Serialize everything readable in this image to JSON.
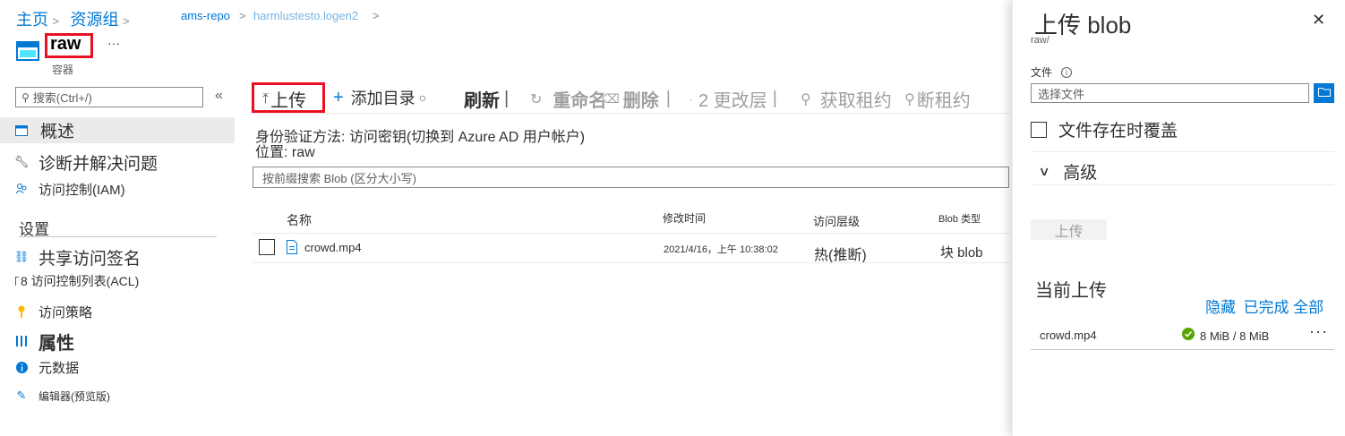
{
  "breadcrumb": {
    "home": "主页",
    "resource_group": "资源组",
    "repo": "ams-repo",
    "account": "harmlustesto.logen2",
    "sep": ">"
  },
  "container": {
    "name": "raw",
    "subtitle": "容器",
    "more": "···"
  },
  "sidebar": {
    "search_placeholder": "搜索(Ctrl+/)",
    "collapse": "«",
    "items": [
      {
        "label": "概述",
        "icon": "container-icon"
      },
      {
        "label": "诊断并解决问题",
        "icon": "wrench-icon"
      },
      {
        "label": "访问控制(IAM)",
        "icon": "people-icon"
      }
    ],
    "settings_header": "设置",
    "settings_items": [
      {
        "label": "共享访问签名",
        "icon": "link-icon"
      },
      {
        "label": "8 访问控制列表(ACL)",
        "icon": "acl-icon"
      },
      {
        "label": "访问策略",
        "icon": "key-icon"
      },
      {
        "label": "属性",
        "icon": "properties-icon"
      },
      {
        "label": "元数据",
        "icon": "info-icon"
      },
      {
        "label": "编辑器(预览版)",
        "icon": "pencil-icon"
      }
    ]
  },
  "toolbar": {
    "upload": "上传",
    "add_directory": "添加目录",
    "refresh": "刷新",
    "rename": "重命名",
    "delete": "删除",
    "change_tier": "2 更改层",
    "acquire_lease": "获取租约",
    "break_lease": "断租约"
  },
  "main": {
    "auth_method": "身份验证方法: 访问密钥(切换到 Azure AD 用户帐户)",
    "location": "位置: raw",
    "search_placeholder": "按前缀搜索 Blob (区分大小写)",
    "columns": [
      "名称",
      "修改时间",
      "访问层级",
      "Blob 类型"
    ],
    "rows": [
      {
        "name": "crowd.mp4",
        "modified": "2021/4/16，上午 10:38:02",
        "tier": "热(推断)",
        "blob_type": "块 blob"
      }
    ]
  },
  "panel": {
    "title": "上传 blob",
    "subtitle": "raw/",
    "close": "✕",
    "file_label": "文件",
    "file_placeholder": "选择文件",
    "overwrite_label": "文件存在时覆盖",
    "advanced_label": "高级",
    "upload_button": "上传",
    "current_uploads": "当前上传",
    "hide": "隐藏",
    "completed_all": "已完成 全部",
    "upload_item": {
      "name": "crowd.mp4",
      "progress_text": "8 MiB / 8 MiB",
      "progress": 1.0,
      "status": "completed"
    }
  },
  "colors": {
    "accent": "#0078d4",
    "highlight": "#e81123",
    "success": "#57a300"
  }
}
